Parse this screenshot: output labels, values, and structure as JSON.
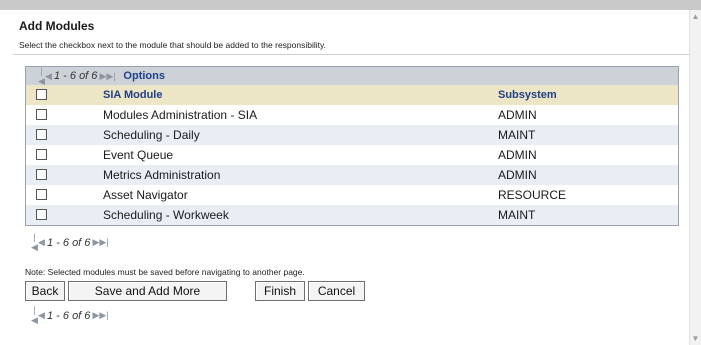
{
  "title": "Add Modules",
  "subtitle": "Select the checkbox next to the module that should be added to the responsibility.",
  "pager": {
    "count": "1 - 6 of 6",
    "options": "Options"
  },
  "table": {
    "headers": {
      "module": "SIA Module",
      "subsystem": "Subsystem"
    },
    "rows": [
      {
        "module": "Modules Administration - SIA",
        "subsystem": "ADMIN"
      },
      {
        "module": "Scheduling - Daily",
        "subsystem": "MAINT"
      },
      {
        "module": "Event Queue",
        "subsystem": "ADMIN"
      },
      {
        "module": "Metrics Administration",
        "subsystem": "ADMIN"
      },
      {
        "module": "Asset Navigator",
        "subsystem": "RESOURCE"
      },
      {
        "module": "Scheduling - Workweek",
        "subsystem": "MAINT"
      }
    ]
  },
  "note": "Note: Selected modules must be saved before navigating to another page.",
  "buttons": {
    "back": "Back",
    "save_add_more": "Save and Add More",
    "finish": "Finish",
    "cancel": "Cancel"
  }
}
